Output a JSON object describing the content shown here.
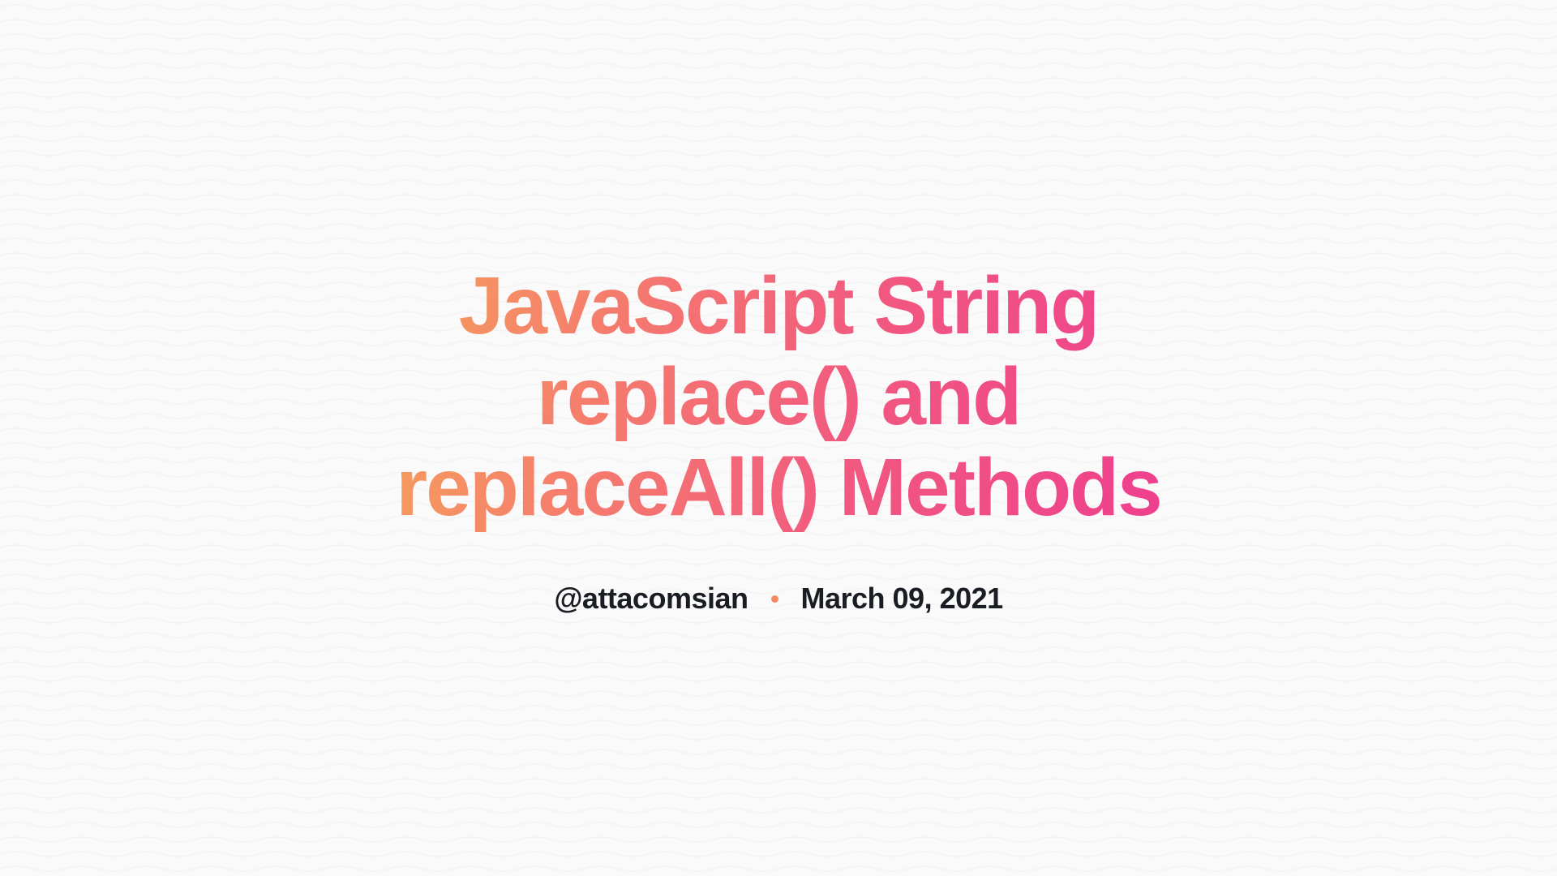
{
  "title": "JavaScript String replace() and replaceAll() Methods",
  "author": "@attacomsian",
  "date": "March 09, 2021"
}
